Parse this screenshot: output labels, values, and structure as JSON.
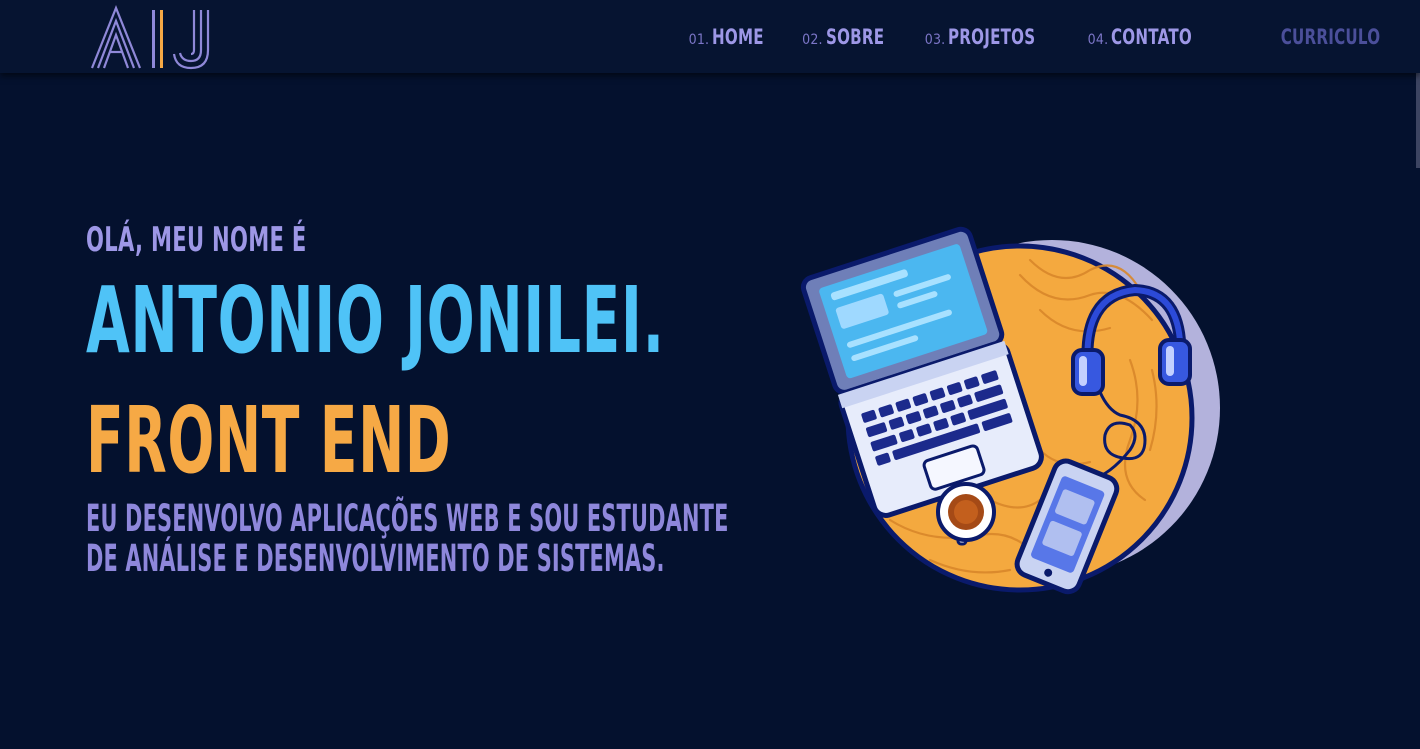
{
  "logo": {
    "alt": "AJ"
  },
  "nav": {
    "items": [
      {
        "num": "01.",
        "label": "HOME"
      },
      {
        "num": "02.",
        "label": "SOBRE"
      },
      {
        "num": "03.",
        "label": "PROJETOS"
      },
      {
        "num": "04.",
        "label": "CONTATO"
      }
    ],
    "resume_label": "CURRICULO"
  },
  "hero": {
    "greeting": "OLÁ, MEU NOME É",
    "name": "ANTONIO JONILEI.",
    "role": "FRONT END",
    "description_line1": "EU DESENVOLVO APLICAÇÕES WEB E SOU ESTUDANTE",
    "description_line2": "DE ANÁLISE E DESENVOLVIMENTO DE SISTEMAS."
  },
  "colors": {
    "background": "#04112e",
    "navbar": "#061431",
    "accent_blue": "#4fc3f7",
    "accent_orange": "#f6a945",
    "accent_purple": "#9d97e6"
  },
  "icons": {
    "logo": "aj-monogram-logo",
    "illustration": "laptop-headphones-phone-coffee-illustration"
  }
}
